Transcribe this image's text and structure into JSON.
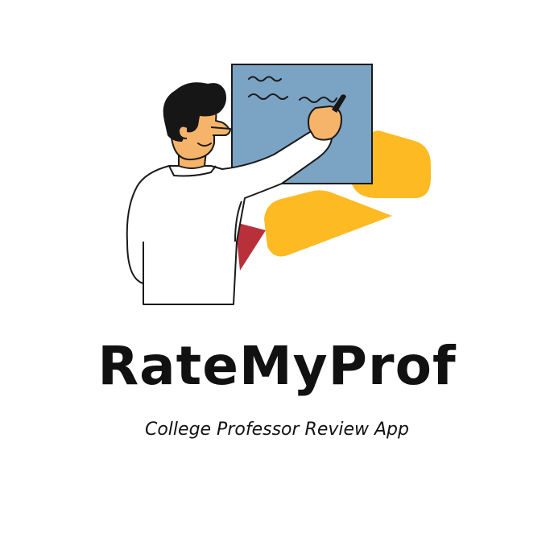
{
  "logo": {
    "illustration_icon": "teacher-writing-on-board-icon",
    "colors": {
      "board": "#7BA3C4",
      "accent_yellow": "#FDBA22",
      "accent_red": "#B8303A",
      "skin": "#F6B46A",
      "hair": "#161616",
      "outline": "#1A1A1A",
      "shirt": "#FFFFFF"
    }
  },
  "brand": {
    "name": "RateMyProf",
    "tagline": "College Professor Review App"
  }
}
